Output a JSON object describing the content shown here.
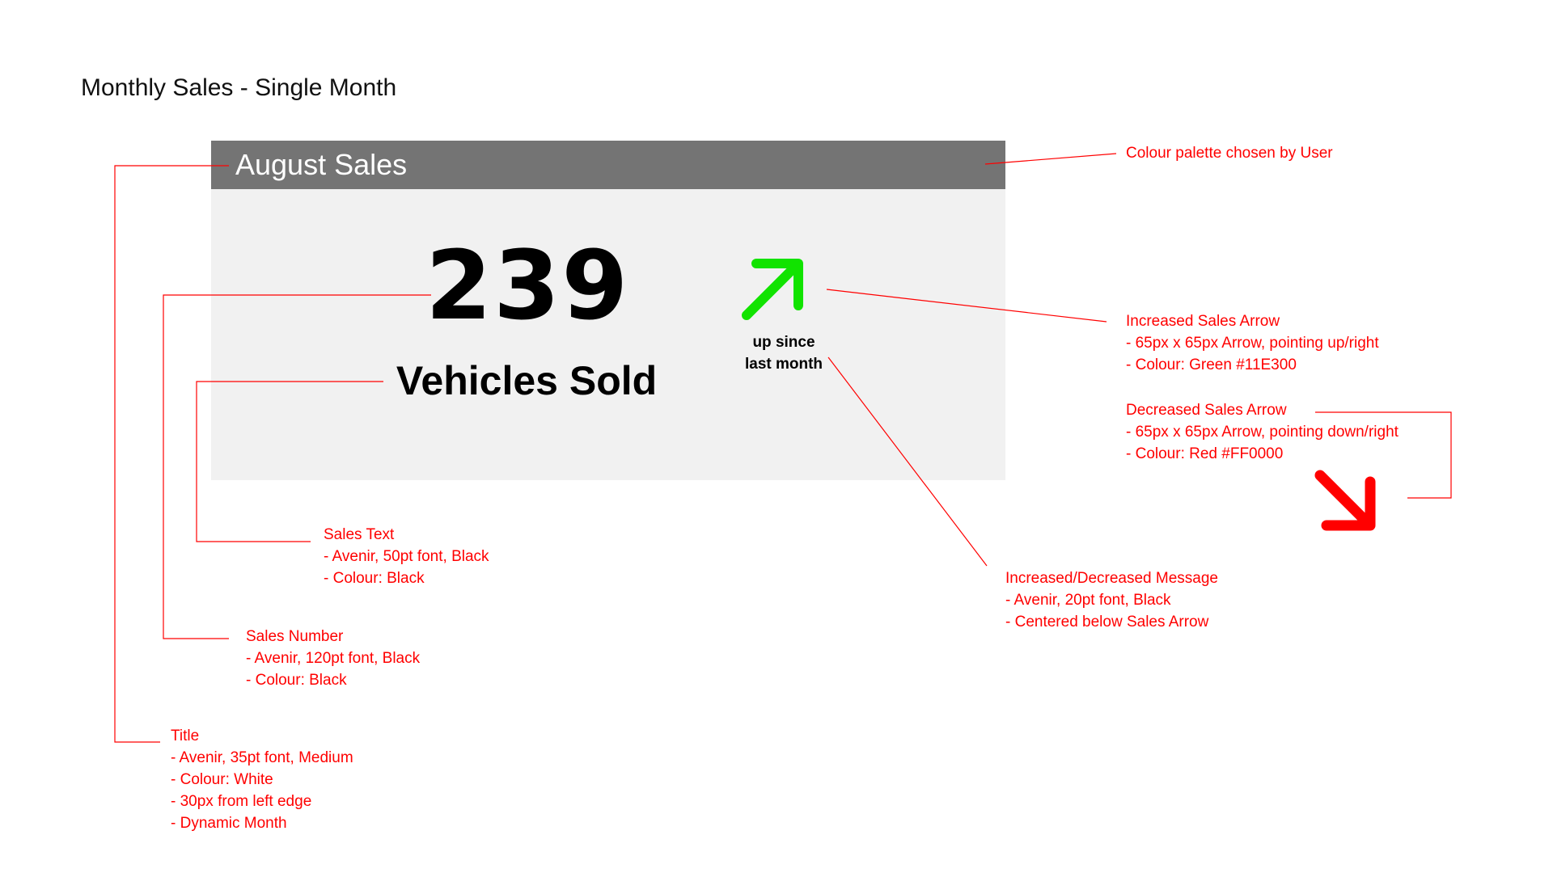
{
  "page": {
    "title": "Monthly Sales - Single Month"
  },
  "card": {
    "title": "August Sales",
    "sales_number": "239",
    "sales_text": "Vehicles Sold",
    "change_message": {
      "line1": "up since",
      "line2": "last month"
    },
    "header_color": "#747474",
    "body_color": "#f1f1f1"
  },
  "icons": {
    "increase": "arrow-up-right-icon",
    "decrease": "arrow-down-right-icon"
  },
  "colors": {
    "annotation": "#FF0000",
    "increase_arrow": "#11E300",
    "decrease_arrow": "#FF0000"
  },
  "annotations": {
    "palette": {
      "heading": "Colour palette chosen by User"
    },
    "increase_arrow": {
      "heading": "Increased Sales Arrow",
      "lines": [
        "- 65px x 65px Arrow, pointing up/right",
        "- Colour: Green #11E300"
      ]
    },
    "decrease_arrow": {
      "heading": "Decreased Sales Arrow",
      "lines": [
        "- 65px x 65px Arrow, pointing down/right",
        "- Colour: Red #FF0000"
      ]
    },
    "message": {
      "heading": "Increased/Decreased Message",
      "lines": [
        "- Avenir, 20pt font, Black",
        "- Centered below Sales Arrow"
      ]
    },
    "sales_text": {
      "heading": "Sales Text",
      "lines": [
        "- Avenir, 50pt font, Black",
        "- Colour: Black"
      ]
    },
    "sales_number": {
      "heading": "Sales Number",
      "lines": [
        "- Avenir, 120pt font, Black",
        "- Colour: Black"
      ]
    },
    "title": {
      "heading": "Title",
      "lines": [
        "- Avenir, 35pt font, Medium",
        "- Colour: White",
        "- 30px from left edge",
        "- Dynamic Month"
      ]
    }
  }
}
